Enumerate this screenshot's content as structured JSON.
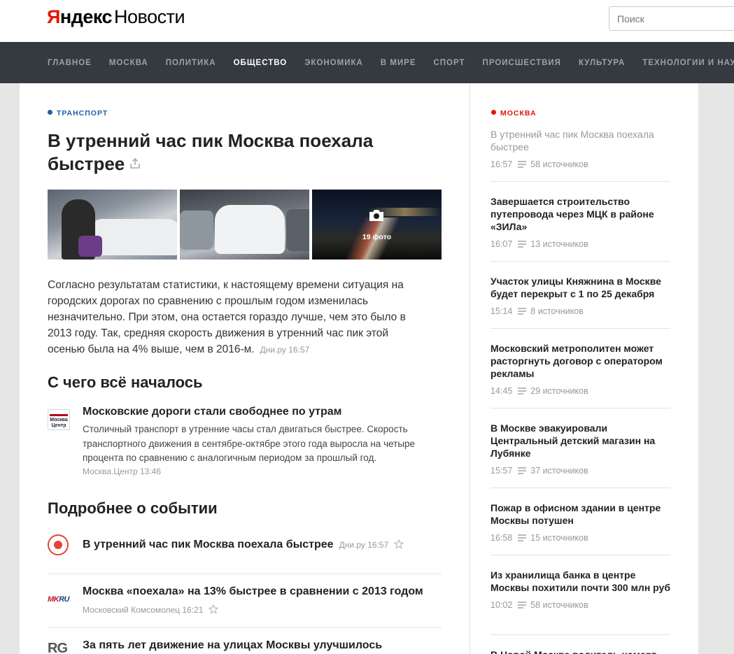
{
  "header": {
    "logo_brand": "Яндекс",
    "logo_product": "Новости",
    "search_placeholder": "Поиск"
  },
  "nav": {
    "items": [
      "ГЛАВНОЕ",
      "МОСКВА",
      "ПОЛИТИКА",
      "ОБЩЕСТВО",
      "ЭКОНОМИКА",
      "В МИРЕ",
      "СПОРТ",
      "ПРОИСШЕСТВИЯ",
      "КУЛЬТУРА",
      "ТЕХНОЛОГИИ И НАУКА"
    ],
    "active": "ОБЩЕСТВО"
  },
  "article": {
    "rubric": "ТРАНСПОРТ",
    "title": "В утренний час пик Москва поехала быстрее",
    "photo_count": "19 фото",
    "lead": "Согласно результатам статистики, к настоящему времени ситуация на городских дорогах по сравнению с прошлым годом изменилась незначительно. При этом, она остается гораздо лучше, чем это было в 2013 году. Так, средняя скорость движения в утренний час пик этой осенью была на 4% выше, чем в 2016-м.",
    "lead_source": "Дни.ру 16:57",
    "origin_heading": "С чего всё началось",
    "origin": {
      "logo_text": "Москва Центр",
      "title": "Московские дороги стали свободнее по утрам",
      "text": "Столичный транспорт в утренние часы стал двигаться быстрее. Скорость транспортного движения в сентябре-октябре этого года выросла на четыре процента по сравнению с аналогичным периодом за прошлый год.",
      "source": "Москва.Центр 13:46"
    },
    "more_heading": "Подробнее о событии",
    "stories": [
      {
        "title": "В утренний час пик Москва поехала быстрее",
        "source": "Дни.ру 16:57"
      },
      {
        "title": "Москва «поехала» на 13% быстрее в сравнении с 2013 годом",
        "source": "Московский Комсомолец 16:21",
        "logo": "MK.RU"
      },
      {
        "title": "За пять лет движение на улицах Москвы улучшилось",
        "logo": "RG"
      }
    ]
  },
  "sidebar": {
    "rubric": "МОСКВА",
    "items": [
      {
        "title": "В утренний час пик Москва поехала быстрее",
        "time": "16:57",
        "sources": "58 источников"
      },
      {
        "title": "Завершается строительство путепровода через МЦК в районе «ЗИЛа»",
        "time": "16:07",
        "sources": "13 источников"
      },
      {
        "title": "Участок улицы Княжнина в Москве будет перекрыт с 1 по 25 декабря",
        "time": "15:14",
        "sources": "8 источников"
      },
      {
        "title": "Московский метрополитен может расторгнуть договор с оператором рекламы",
        "time": "14:45",
        "sources": "29 источников"
      },
      {
        "title": "В Москве эвакуировали Центральный детский магазин на Лубянке",
        "time": "15:57",
        "sources": "37 источников"
      },
      {
        "title": "Пожар в офисном здании в центре Москвы потушен",
        "time": "16:58",
        "sources": "15 источников"
      },
      {
        "title": "Из хранилища банка в центре Москвы похитили почти 300 млн руб",
        "time": "10:02",
        "sources": "58 источников"
      }
    ],
    "partial_title": "В Новой Москве водитель намерт..."
  },
  "colors": {
    "brand_red": "#e61400",
    "nav_bg": "#353a40",
    "rubric_blue": "#1f5fa8"
  }
}
